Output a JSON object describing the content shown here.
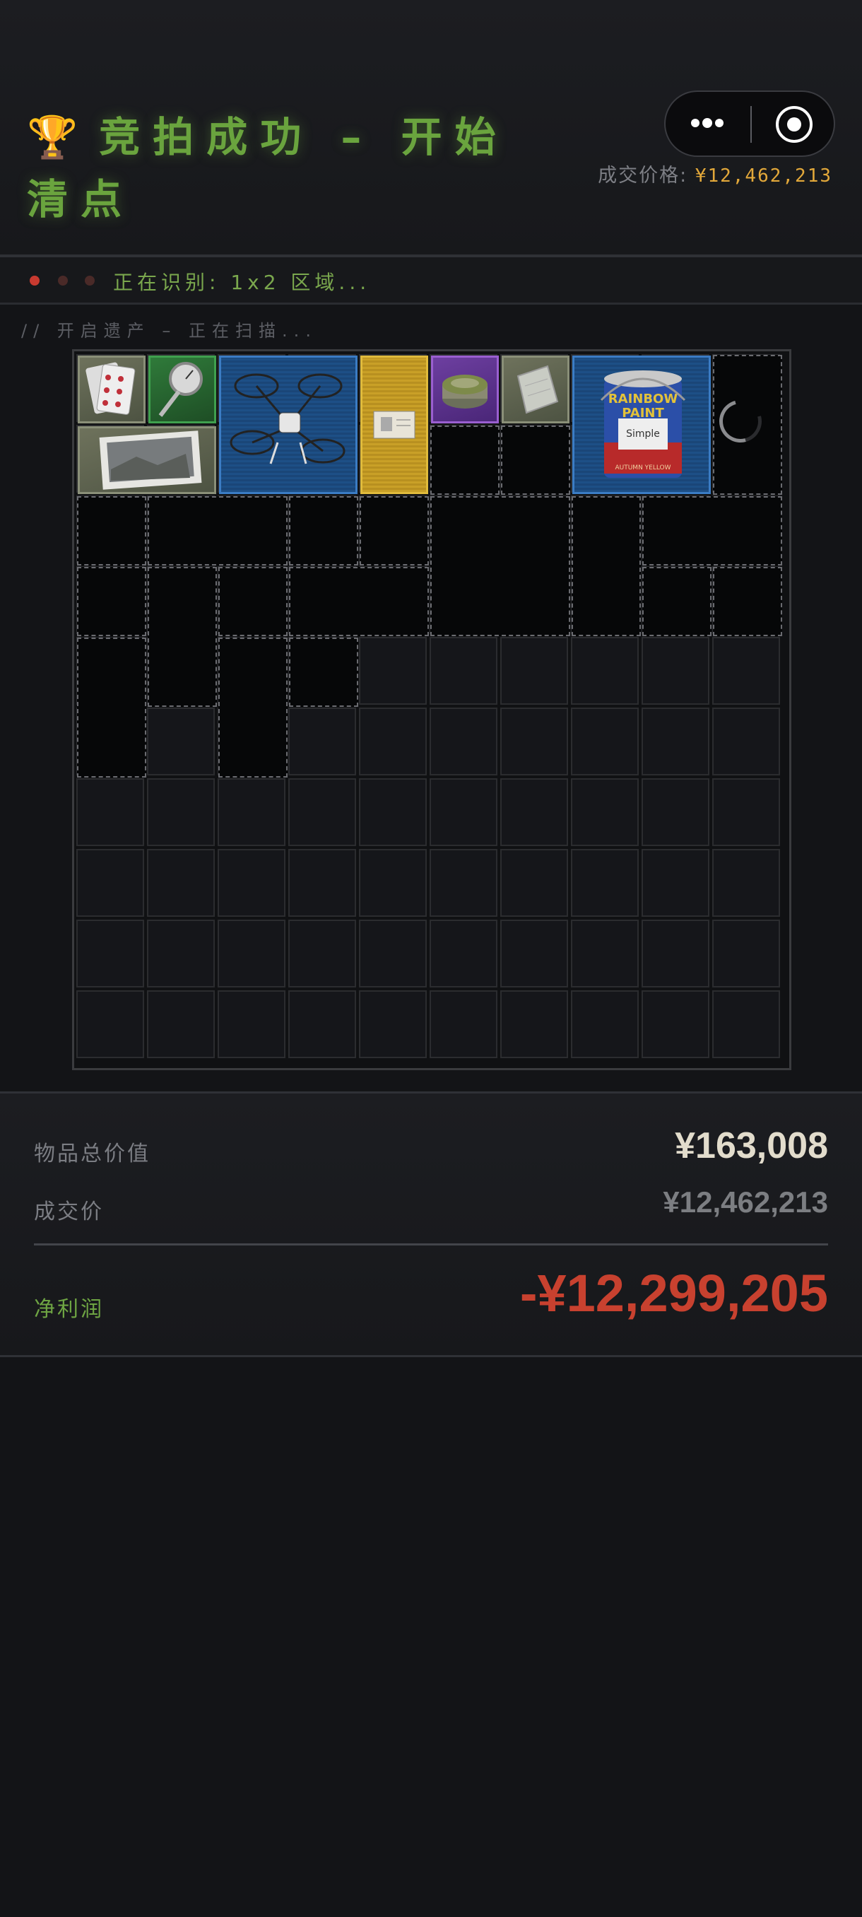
{
  "header": {
    "trophy_icon": "🏆",
    "title": "竞拍成功 – 开始清点",
    "deal_label": "成交价格:",
    "deal_value": "¥12,462,213"
  },
  "status": {
    "text": "正在识别: 1x2 区域...",
    "scan_text": "// 开启遗产 – 正在扫描..."
  },
  "grid": {
    "cols": 10,
    "rows": 10
  },
  "summary": {
    "total_label": "物品总价值",
    "total_value": "¥163,008",
    "deal_label": "成交价",
    "deal_value": "¥12,462,213",
    "profit_label": "净利润",
    "profit_value": "-¥12,299,205"
  },
  "colors": {
    "accent_green": "#6aa43e",
    "gold": "#e2a83a",
    "loss_red": "#c8412f"
  }
}
